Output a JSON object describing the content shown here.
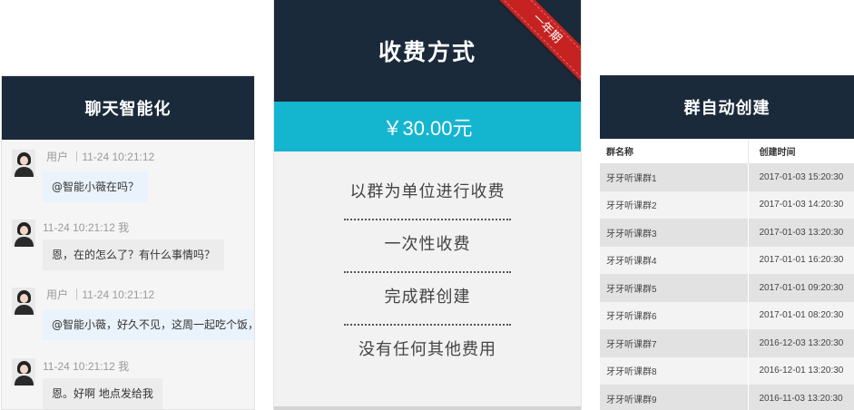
{
  "chat": {
    "title": "聊天智能化",
    "messages": [
      {
        "side": "in",
        "meta": "用户 ｜11-24  10:21:12",
        "text": "@智能小薇在吗？"
      },
      {
        "side": "out",
        "meta": "11-24  10:21:12  我",
        "text": "恩，在的怎么了？有什么事情吗？"
      },
      {
        "side": "in",
        "meta": "用户 ｜11-24  10:21:12",
        "text": "@智能小薇，好久不见，这周一起吃个饭，"
      },
      {
        "side": "out",
        "meta": "11-24  10:21:12  我",
        "text": "恩。好啊  地点发给我"
      }
    ]
  },
  "pricing": {
    "title": "收费方式",
    "ribbon": "一年期",
    "price": "￥30.00元",
    "features": [
      "以群为单位进行收费",
      "一次性收费",
      "完成群创建",
      "没有任何其他费用"
    ]
  },
  "groups": {
    "title": "群自动创建",
    "columns": [
      "群名称",
      "创建时间"
    ],
    "rows": [
      [
        "牙牙听课群1",
        "2017-01-03 15:20:30"
      ],
      [
        "牙牙听课群2",
        "2017-01-03 14:20:30"
      ],
      [
        "牙牙听课群3",
        "2017-01-03 13:20:30"
      ],
      [
        "牙牙听课群4",
        "2017-01-01 16:20:30"
      ],
      [
        "牙牙听课群5",
        "2017-01-01 09:20:30"
      ],
      [
        "牙牙听课群6",
        "2017-01-01 08:20:30"
      ],
      [
        "牙牙听课群7",
        "2016-12-03 13:20:30"
      ],
      [
        "牙牙听课群8",
        "2016-12-01 13:20:30"
      ],
      [
        "牙牙听课群9",
        "2016-11-03 13:20:30"
      ]
    ]
  }
}
